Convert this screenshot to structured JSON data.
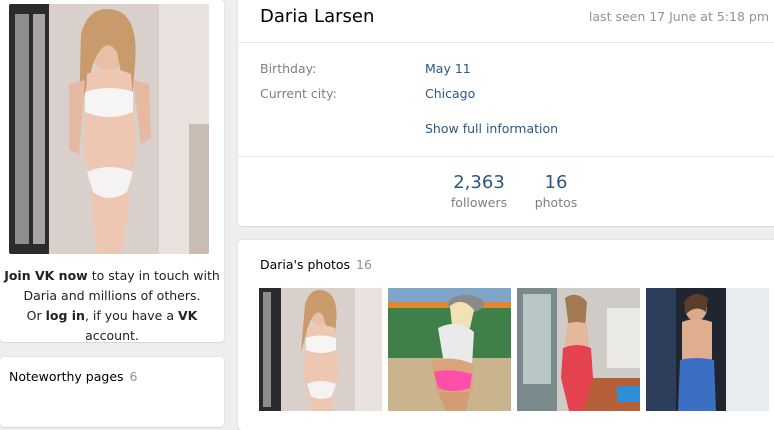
{
  "profile": {
    "name": "Daria Larsen",
    "last_seen": "last seen 17 June at 5:18 pm",
    "info_rows": [
      {
        "label": "Birthday:",
        "value": "May 11"
      },
      {
        "label": "Current city:",
        "value": "Chicago"
      }
    ],
    "show_full": "Show full information",
    "counters": [
      {
        "value": "2,363",
        "label": "followers"
      },
      {
        "value": "16",
        "label": "photos"
      }
    ]
  },
  "join": {
    "join_link": "Join VK now",
    "line1_rest": " to stay in touch with",
    "line2": "Daria and millions of others.",
    "or": "Or ",
    "login_link": "log in",
    "line3_mid": ", if you have a ",
    "vk": "VK",
    "line3_end": " account."
  },
  "noteworthy": {
    "title": "Noteworthy pages",
    "count": "6"
  },
  "photos": {
    "title": "Daria's photos",
    "count": "16"
  },
  "colors": {
    "link": "#2a5885",
    "muted": "#939393",
    "background": "#edeef0"
  }
}
